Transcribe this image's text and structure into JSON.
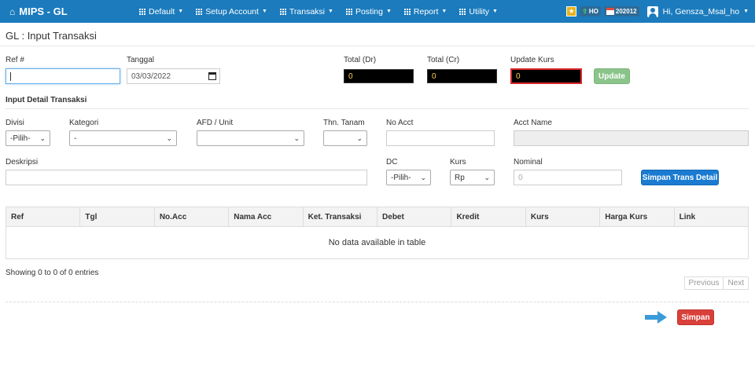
{
  "navbar": {
    "brand": "MIPS - GL",
    "menu": [
      {
        "label": "Default"
      },
      {
        "label": "Setup Account"
      },
      {
        "label": "Transaksi"
      },
      {
        "label": "Posting"
      },
      {
        "label": "Report"
      },
      {
        "label": "Utility"
      }
    ],
    "ho_label": "HO",
    "period": "202012",
    "user": "Hi, Gensza_Msal_ho"
  },
  "page": {
    "title": "GL : Input Transaksi"
  },
  "header_form": {
    "ref_label": "Ref #",
    "ref_value": "",
    "tanggal_label": "Tanggal",
    "tanggal_value": "03/03/2022",
    "total_dr_label": "Total (Dr)",
    "total_dr_value": "0",
    "total_cr_label": "Total (Cr)",
    "total_cr_value": "0",
    "update_kurs_label": "Update Kurs",
    "update_kurs_value": "0",
    "update_button": "Update"
  },
  "detail": {
    "section_title": "Input Detail Transaksi",
    "divisi_label": "Divisi",
    "divisi_value": "-Pilih-",
    "kategori_label": "Kategori",
    "kategori_value": "-",
    "afd_label": "AFD / Unit",
    "afd_value": "",
    "thn_label": "Thn. Tanam",
    "thn_value": "",
    "noacct_label": "No Acct",
    "noacct_value": "",
    "acctname_label": "Acct Name",
    "acctname_value": "",
    "deskripsi_label": "Deskripsi",
    "deskripsi_value": "",
    "dc_label": "DC",
    "dc_value": "-Pilih-",
    "kurs_label": "Kurs",
    "kurs_value": "Rp",
    "nominal_label": "Nominal",
    "nominal_placeholder": "0",
    "simpan_detail_button": "Simpan Trans Detail"
  },
  "table": {
    "columns": [
      "Ref",
      "Tgl",
      "No.Acc",
      "Nama Acc",
      "Ket. Transaksi",
      "Debet",
      "Kredit",
      "Kurs",
      "Harga Kurs",
      "Link"
    ],
    "empty_message": "No data available in table",
    "info": "Showing 0 to 0 of 0 entries",
    "previous": "Previous",
    "next": "Next"
  },
  "footer": {
    "simpan_button": "Simpan"
  },
  "colors": {
    "navbar": "#1b7bbd",
    "update_button": "#8bc48b",
    "simpan_detail_button": "#1a7bd1",
    "simpan_button": "#d9403a",
    "arrow": "#3a9bd9"
  },
  "icons": {
    "home": "home-icon",
    "menu": "grid-icon",
    "star": "star-icon",
    "ho": "arrow-up-icon",
    "period": "calendar-icon",
    "user": "user-icon",
    "arrow": "arrow-right-icon"
  }
}
